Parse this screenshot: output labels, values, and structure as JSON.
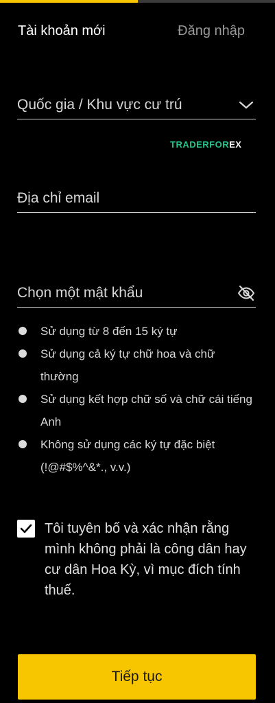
{
  "progress": {
    "fraction": 0.5,
    "fill_color": "#f7c600",
    "track_color": "#3a3a3a"
  },
  "tabs": {
    "new_account": "Tài khoản mới",
    "login": "Đăng nhập"
  },
  "form": {
    "country": {
      "label": "Quốc gia / Khu vực cư trú",
      "icon": "chevron-down-icon"
    },
    "email": {
      "label": "Địa chỉ email"
    },
    "password": {
      "label": "Chọn một mật khẩu",
      "icon": "eye-off-icon"
    }
  },
  "watermark": {
    "part1": "TRADERFOR",
    "part2": "EX"
  },
  "password_rules": [
    "Sử dụng từ 8 đến 15 ký tự",
    "Sử dụng cả ký tự chữ hoa và chữ thường",
    "Sử dụng kết hợp chữ số và chữ cái tiếng Anh",
    "Không sử dụng các ký tự đặc biệt (!@#$%^&*., v.v.)"
  ],
  "declaration": {
    "checked": true,
    "text": "Tôi tuyên bố và xác nhận rằng mình không phải là công dân hay cư dân Hoa Kỳ, vì mục đích tính thuế."
  },
  "submit_label": "Tiếp tục",
  "colors": {
    "accent": "#f7c600",
    "background": "#000000",
    "watermark": "#22c48a"
  }
}
